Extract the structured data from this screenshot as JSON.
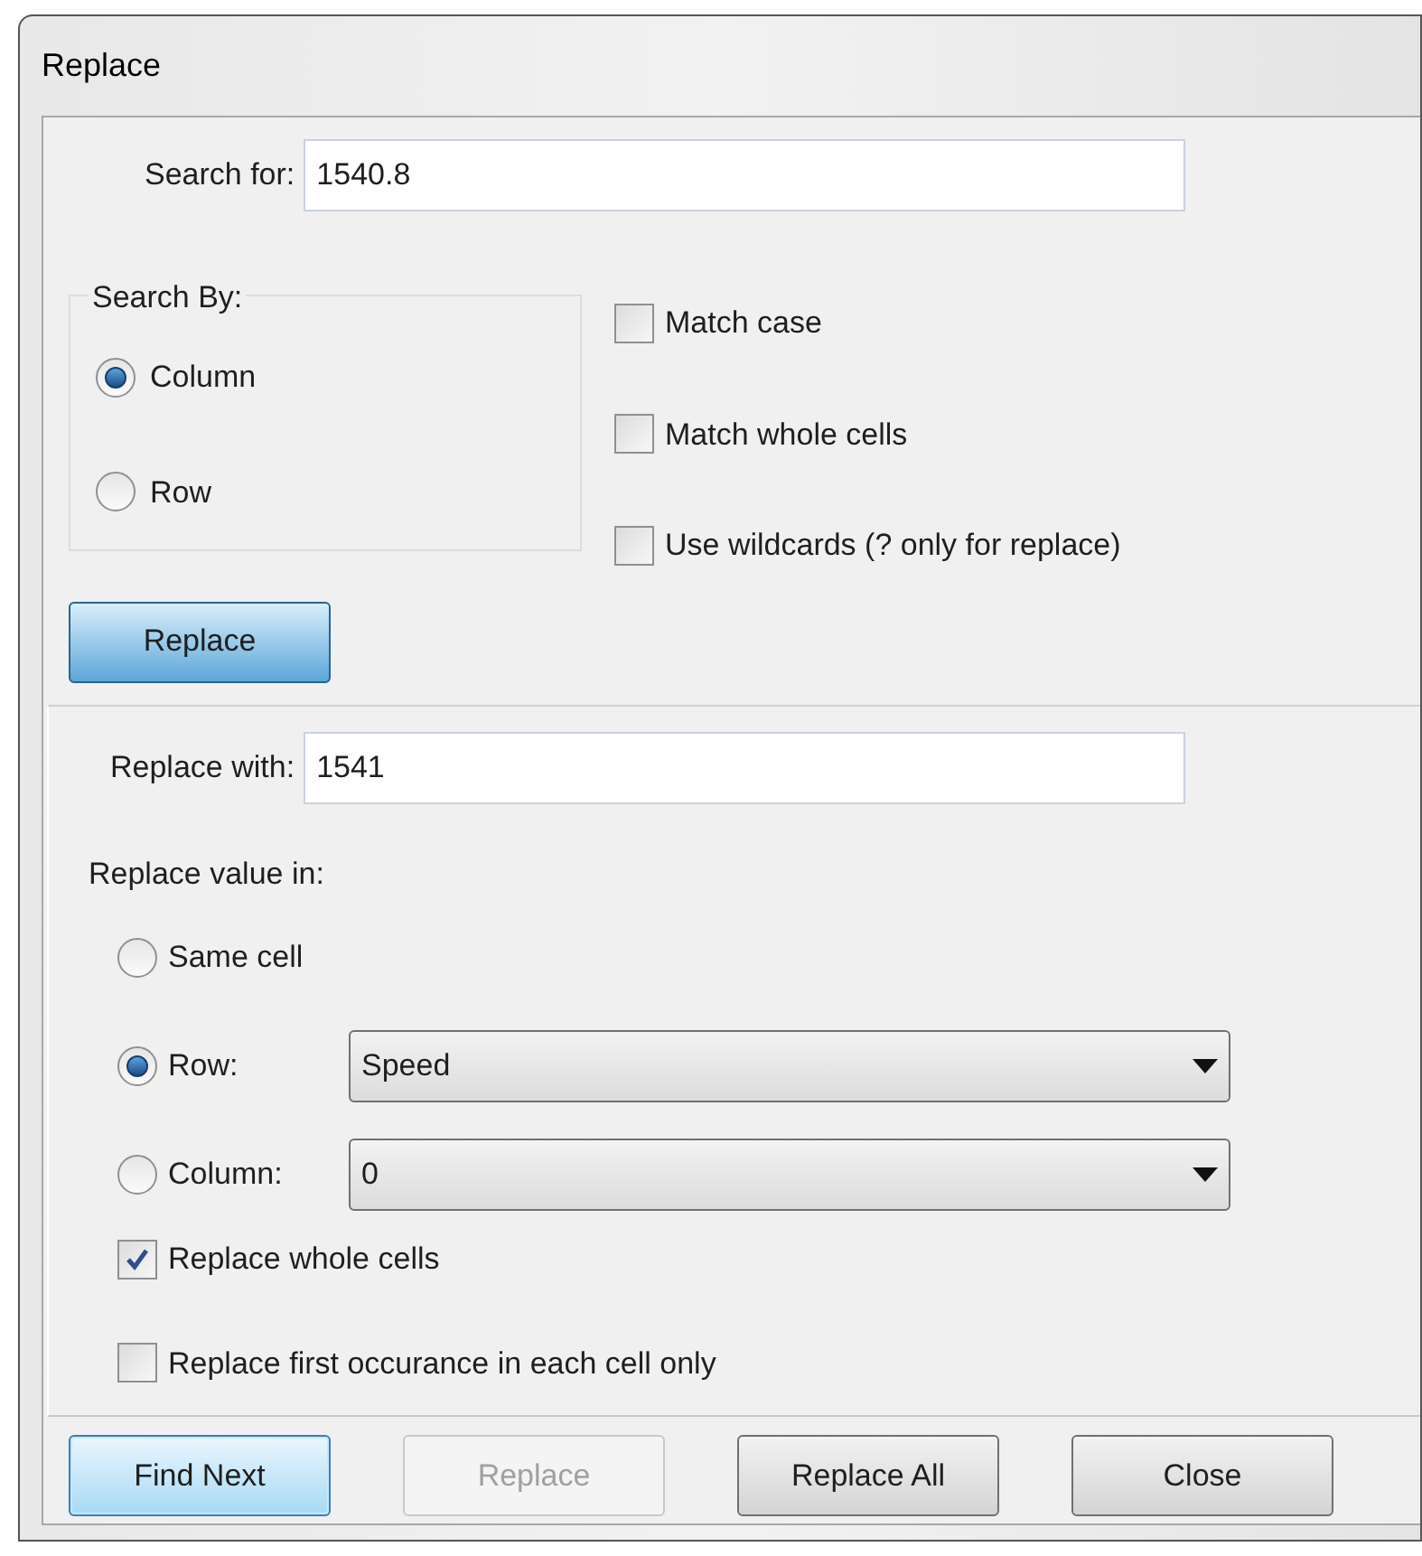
{
  "window": {
    "title": "Replace"
  },
  "search_for": {
    "label": "Search for:",
    "value": "1540.8"
  },
  "search_by": {
    "title": "Search By:",
    "options": [
      {
        "label": "Column",
        "selected": true
      },
      {
        "label": "Row",
        "selected": false
      }
    ]
  },
  "match_options": [
    {
      "label": "Match case",
      "checked": false
    },
    {
      "label": "Match whole cells",
      "checked": false
    },
    {
      "label": "Use wildcards (? only for replace)",
      "checked": false
    }
  ],
  "replace_toggle": {
    "label": "Replace",
    "pressed": true
  },
  "replace_with": {
    "label": "Replace with:",
    "value": "1541"
  },
  "replace_value_in": {
    "title": "Replace value in:",
    "options": [
      {
        "label": "Same cell",
        "selected": false,
        "kind": "plain"
      },
      {
        "label": "Row:",
        "selected": true,
        "kind": "dropdown",
        "value": "Speed"
      },
      {
        "label": "Column:",
        "selected": false,
        "kind": "dropdown",
        "value": "0"
      }
    ]
  },
  "replace_options": [
    {
      "label": "Replace whole cells",
      "checked": true
    },
    {
      "label": "Replace first occurance in each cell only",
      "checked": false
    }
  ],
  "buttons": [
    {
      "label": "Find Next",
      "default": true,
      "disabled": false
    },
    {
      "label": "Replace",
      "default": false,
      "disabled": true
    },
    {
      "label": "Replace All",
      "default": false,
      "disabled": false
    },
    {
      "label": "Close",
      "default": false,
      "disabled": false
    }
  ]
}
